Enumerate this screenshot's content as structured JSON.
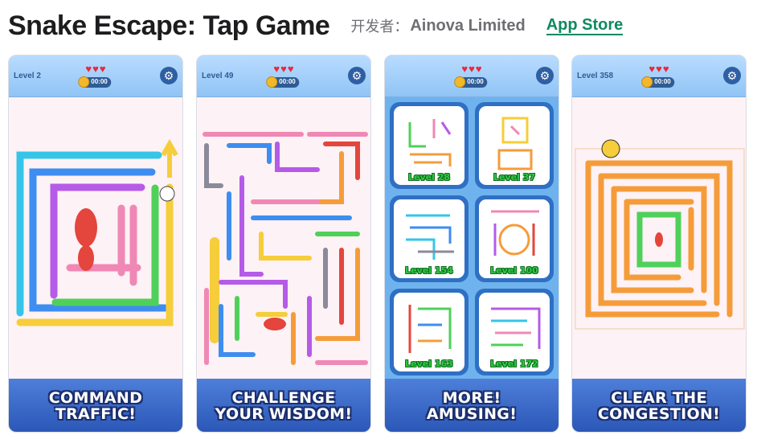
{
  "header": {
    "title": "Snake Escape: Tap Game",
    "developer_label": "开发者：",
    "developer_name": "Ainova Limited",
    "store_link": "App Store"
  },
  "colors": {
    "store_link": "#0f8a5f",
    "banner": "#2c57b8",
    "hearts": "#e8283c"
  },
  "screenshots": [
    {
      "level": "Level 2",
      "timer": "00:00",
      "banner": [
        "COMMAND",
        "TRAFFIC!"
      ]
    },
    {
      "level": "Level 49",
      "timer": "00:00",
      "banner": [
        "CHALLENGE",
        "YOUR WISDOM!"
      ]
    },
    {
      "level": "",
      "timer": "00:00",
      "banner": [
        "MORE!",
        "AMUSING!"
      ],
      "level_cards": [
        "Level 28",
        "Level 37",
        "Level 154",
        "Level 100",
        "Level 163",
        "Level 172"
      ]
    },
    {
      "level": "Level 358",
      "timer": "00:00",
      "banner": [
        "CLEAR THE",
        "CONGESTION!"
      ]
    }
  ],
  "icons": {
    "settings": "gear-icon",
    "heart": "heart-icon",
    "coin": "coin-icon",
    "hand": "pointer-hand-icon",
    "pacman": "pacman-icon"
  }
}
